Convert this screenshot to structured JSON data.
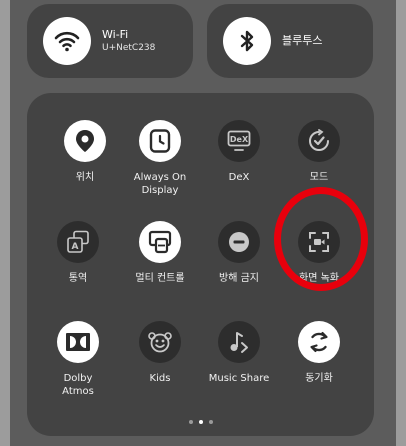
{
  "wifi": {
    "title": "Wi-Fi",
    "network": "U+NetC238"
  },
  "bluetooth": {
    "title": "블루투스"
  },
  "tiles": [
    {
      "label": "위치",
      "icon": "location-pin-icon",
      "active": true
    },
    {
      "label": "Always On\nDisplay",
      "icon": "clock-icon",
      "active": true
    },
    {
      "label": "DeX",
      "icon": "dex-icon",
      "active": false
    },
    {
      "label": "모드",
      "icon": "modes-icon",
      "active": false
    },
    {
      "label": "통역",
      "icon": "interpreter-icon",
      "active": false
    },
    {
      "label": "멀티 컨트롤",
      "icon": "multi-control-icon",
      "active": true
    },
    {
      "label": "방해 금지",
      "icon": "do-not-disturb-icon",
      "active": false
    },
    {
      "label": "화면 녹화",
      "icon": "screen-recorder-icon",
      "active": false
    },
    {
      "label": "Dolby\nAtmos",
      "icon": "dolby-atmos-icon",
      "active": true
    },
    {
      "label": "Kids",
      "icon": "kids-icon",
      "active": false
    },
    {
      "label": "Music Share",
      "icon": "music-share-icon",
      "active": false
    },
    {
      "label": "동기화",
      "icon": "sync-icon",
      "active": true
    }
  ],
  "pagination": {
    "pages": 3,
    "current": 2
  },
  "colors": {
    "annotation": "#e8000c",
    "panel": "#434343",
    "active_tile": "#ffffff",
    "inactive_tile": "#2d2d2d"
  }
}
